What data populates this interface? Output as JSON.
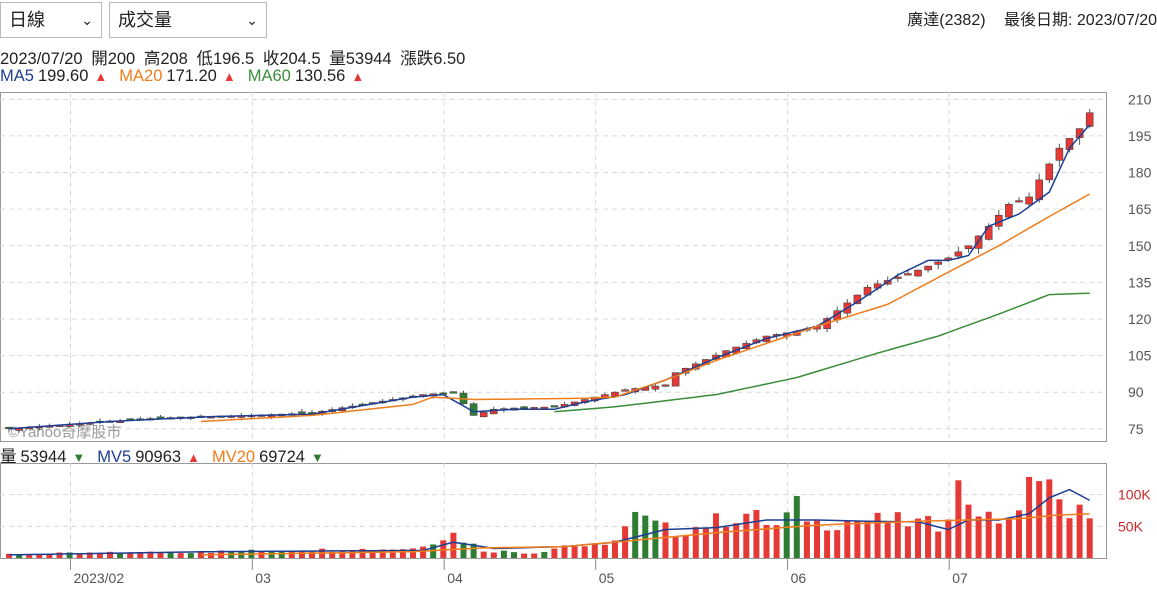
{
  "controls": {
    "period": {
      "selected": "日線"
    },
    "indicator": {
      "selected": "成交量"
    }
  },
  "header": {
    "stock": "廣達(2382)",
    "last_date_label": "最後日期: 2023/07/20"
  },
  "ohlc": {
    "date": "2023/07/20",
    "open": "開200",
    "high": "高208",
    "low": "低196.5",
    "close": "收204.5",
    "volume": "量53944",
    "change": "漲跌6.50"
  },
  "price_legend": [
    {
      "name": "MA5",
      "value": "199.60",
      "arrow": "▲",
      "color": "#1c3f94"
    },
    {
      "name": "MA20",
      "value": "171.20",
      "arrow": "▲",
      "color": "#f07d1a"
    },
    {
      "name": "MA60",
      "value": "130.56",
      "arrow": "▲",
      "color": "#3a8d3a"
    }
  ],
  "volume_legend": [
    {
      "name": "量",
      "value": "53944",
      "arrow": "▼",
      "color": "#222222"
    },
    {
      "name": "MV5",
      "value": "90963",
      "arrow": "▲",
      "color": "#1c3f94"
    },
    {
      "name": "MV20",
      "value": "69724",
      "arrow": "▼",
      "color": "#f07d1a"
    }
  ],
  "watermark": "©Yahoo奇摩股市",
  "colors": {
    "up": "#e53935",
    "down": "#2e7d32",
    "ma5": "#1c3f94",
    "ma20": "#f07d1a",
    "ma60": "#3a8d3a",
    "grid": "#d8d8d8"
  },
  "chart_data": {
    "type": "candlestick",
    "x_tick_labels": [
      "2023/02",
      "03",
      "04",
      "05",
      "06",
      "07"
    ],
    "x_tick_index": [
      5,
      23,
      42,
      57,
      76,
      92
    ],
    "y_ticks": [
      75,
      90,
      105,
      120,
      135,
      150,
      165,
      180,
      195,
      210
    ],
    "ylim": [
      70,
      213
    ],
    "volume_ticks": [
      {
        "value": 50000,
        "label": "50K"
      },
      {
        "value": 100000,
        "label": "100K"
      }
    ],
    "volume_ylim": [
      0,
      150000
    ],
    "x_count": 108,
    "anchors": {
      "close": [
        [
          0,
          75
        ],
        [
          5,
          76.5
        ],
        [
          10,
          78
        ],
        [
          15,
          79.5
        ],
        [
          20,
          80
        ],
        [
          24,
          80.5
        ],
        [
          30,
          81.5
        ],
        [
          35,
          85
        ],
        [
          41,
          89
        ],
        [
          44,
          90
        ],
        [
          46,
          80.5
        ],
        [
          48,
          83
        ],
        [
          50,
          83.5
        ],
        [
          54,
          84
        ],
        [
          57,
          87
        ],
        [
          61,
          91
        ],
        [
          65,
          93
        ],
        [
          66,
          98
        ],
        [
          71,
          107
        ],
        [
          75,
          113
        ],
        [
          78,
          115
        ],
        [
          80,
          117
        ],
        [
          85,
          133
        ],
        [
          90,
          140
        ],
        [
          93,
          145
        ],
        [
          95,
          150
        ],
        [
          97,
          158
        ],
        [
          99,
          167
        ],
        [
          101,
          170
        ],
        [
          102,
          177
        ],
        [
          104,
          190
        ],
        [
          106,
          198
        ],
        [
          107,
          204.5
        ]
      ],
      "ma5": [
        [
          0,
          75
        ],
        [
          10,
          78
        ],
        [
          20,
          80
        ],
        [
          30,
          81
        ],
        [
          40,
          88
        ],
        [
          43,
          89
        ],
        [
          46,
          82
        ],
        [
          50,
          83
        ],
        [
          54,
          83
        ],
        [
          57,
          86
        ],
        [
          61,
          89
        ],
        [
          65,
          95
        ],
        [
          70,
          104
        ],
        [
          75,
          112
        ],
        [
          80,
          117
        ],
        [
          84,
          127
        ],
        [
          88,
          138
        ],
        [
          91,
          144
        ],
        [
          93,
          144
        ],
        [
          95,
          146
        ],
        [
          97,
          158
        ],
        [
          100,
          163
        ],
        [
          103,
          172
        ],
        [
          105,
          190
        ],
        [
          107,
          199.6
        ]
      ],
      "ma20": [
        [
          19,
          78
        ],
        [
          30,
          80.5
        ],
        [
          40,
          85
        ],
        [
          42,
          88
        ],
        [
          46,
          87
        ],
        [
          57,
          87.5
        ],
        [
          60,
          88
        ],
        [
          65,
          95
        ],
        [
          70,
          103
        ],
        [
          80,
          117
        ],
        [
          87,
          126
        ],
        [
          92,
          137
        ],
        [
          98,
          150
        ],
        [
          103,
          162
        ],
        [
          107,
          171.2
        ]
      ],
      "ma60": [
        [
          54,
          82
        ],
        [
          60,
          84
        ],
        [
          70,
          89
        ],
        [
          78,
          96
        ],
        [
          86,
          106
        ],
        [
          92,
          113
        ],
        [
          98,
          122
        ],
        [
          103,
          130
        ],
        [
          107,
          130.56
        ]
      ],
      "volume": [
        [
          0,
          6000
        ],
        [
          20,
          10000
        ],
        [
          40,
          15000
        ],
        [
          42,
          28000
        ],
        [
          44,
          38000
        ],
        [
          47,
          12000
        ],
        [
          52,
          8000
        ],
        [
          55,
          20000
        ],
        [
          59,
          18000
        ],
        [
          62,
          65000
        ],
        [
          66,
          40000
        ],
        [
          70,
          58000
        ],
        [
          73,
          70000
        ],
        [
          76,
          50000
        ],
        [
          78,
          80000
        ],
        [
          80,
          55000
        ],
        [
          84,
          60000
        ],
        [
          88,
          58000
        ],
        [
          92,
          52000
        ],
        [
          94,
          110000
        ],
        [
          97,
          60000
        ],
        [
          100,
          65000
        ],
        [
          102,
          160000
        ],
        [
          104,
          80000
        ],
        [
          106,
          73000
        ],
        [
          107,
          53944
        ]
      ],
      "mv5": [
        [
          0,
          5000
        ],
        [
          20,
          10000
        ],
        [
          41,
          12000
        ],
        [
          44,
          25000
        ],
        [
          48,
          15000
        ],
        [
          55,
          18000
        ],
        [
          60,
          25000
        ],
        [
          65,
          45000
        ],
        [
          70,
          48000
        ],
        [
          75,
          60000
        ],
        [
          80,
          60000
        ],
        [
          85,
          58000
        ],
        [
          90,
          57000
        ],
        [
          93,
          45000
        ],
        [
          95,
          60000
        ],
        [
          98,
          60000
        ],
        [
          101,
          70000
        ],
        [
          103,
          95000
        ],
        [
          105,
          108000
        ],
        [
          107,
          90963
        ]
      ],
      "mv20": [
        [
          19,
          5000
        ],
        [
          40,
          10000
        ],
        [
          47,
          16000
        ],
        [
          55,
          18000
        ],
        [
          62,
          28000
        ],
        [
          70,
          40000
        ],
        [
          80,
          52000
        ],
        [
          90,
          58000
        ],
        [
          95,
          60000
        ],
        [
          100,
          62000
        ],
        [
          104,
          68000
        ],
        [
          107,
          69724
        ]
      ]
    }
  }
}
